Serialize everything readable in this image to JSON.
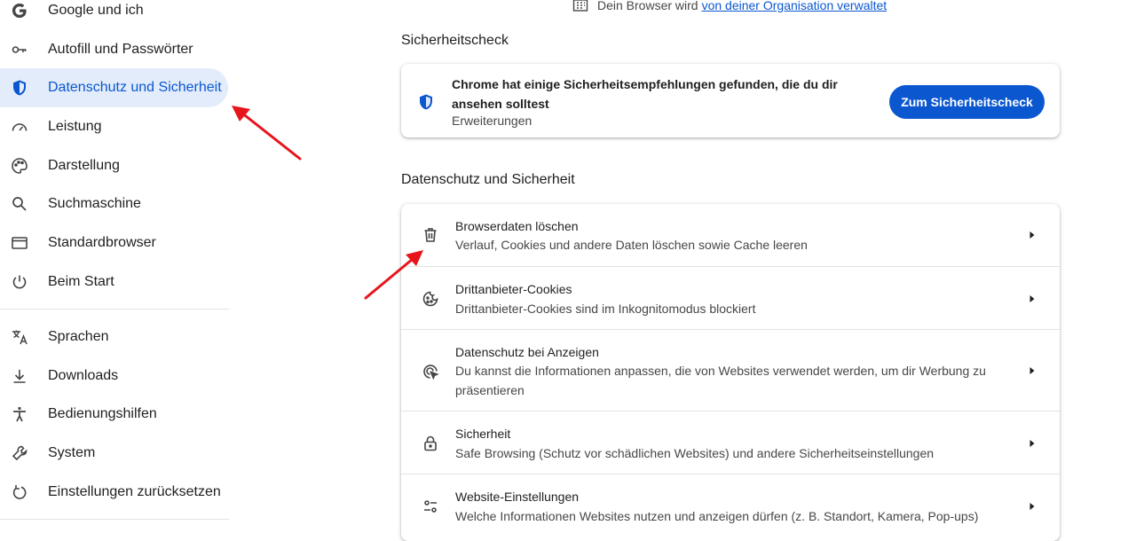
{
  "sidebar": {
    "items": [
      {
        "label": "Google und ich",
        "icon": "google-icon"
      },
      {
        "label": "Autofill und Passwörter",
        "icon": "key-icon"
      },
      {
        "label": "Datenschutz und Sicherheit",
        "icon": "shield-icon",
        "active": true
      },
      {
        "label": "Leistung",
        "icon": "speedometer-icon"
      },
      {
        "label": "Darstellung",
        "icon": "palette-icon"
      },
      {
        "label": "Suchmaschine",
        "icon": "search-icon"
      },
      {
        "label": "Standardbrowser",
        "icon": "browser-window-icon"
      },
      {
        "label": "Beim Start",
        "icon": "power-icon"
      },
      {
        "label": "Sprachen",
        "icon": "translate-icon"
      },
      {
        "label": "Downloads",
        "icon": "download-icon"
      },
      {
        "label": "Bedienungshilfen",
        "icon": "accessibility-icon"
      },
      {
        "label": "System",
        "icon": "wrench-icon"
      },
      {
        "label": "Einstellungen zurücksetzen",
        "icon": "reset-icon"
      }
    ]
  },
  "managed_notice": {
    "text": "Dein Browser wird",
    "link": "von deiner Organisation verwaltet",
    "icon": "building-icon"
  },
  "safety_check": {
    "section_title": "Sicherheitscheck",
    "title": "Chrome hat einige Sicherheitsempfehlungen gefunden, die du dir ansehen solltest",
    "subtitle": "Erweiterungen",
    "button": "Zum Sicherheitscheck"
  },
  "privacy": {
    "section_title": "Datenschutz und Sicherheit",
    "rows": [
      {
        "title": "Browserdaten löschen",
        "subtitle": "Verlauf, Cookies und andere Daten löschen sowie Cache leeren",
        "icon": "trash-icon"
      },
      {
        "title": "Drittanbieter-Cookies",
        "subtitle": "Drittanbieter-Cookies sind im Inkognitomodus blockiert",
        "icon": "cookie-icon"
      },
      {
        "title": "Datenschutz bei Anzeigen",
        "subtitle": "Du kannst die Informationen anpassen, die von Websites verwendet werden, um dir Werbung zu präsentieren",
        "icon": "ad-privacy-icon"
      },
      {
        "title": "Sicherheit",
        "subtitle": "Safe Browsing (Schutz vor schädlichen Websites) und andere Sicherheitseinstellungen",
        "icon": "lock-icon"
      },
      {
        "title": "Website-Einstellungen",
        "subtitle": "Welche Informationen Websites nutzen und anzeigen dürfen (z. B. Standort, Kamera, Pop-ups)",
        "icon": "tune-icon"
      }
    ]
  },
  "colors": {
    "accent": "#0b57d0",
    "active_bg": "#e3ecfb",
    "annotation_arrow": "#e8141c"
  }
}
